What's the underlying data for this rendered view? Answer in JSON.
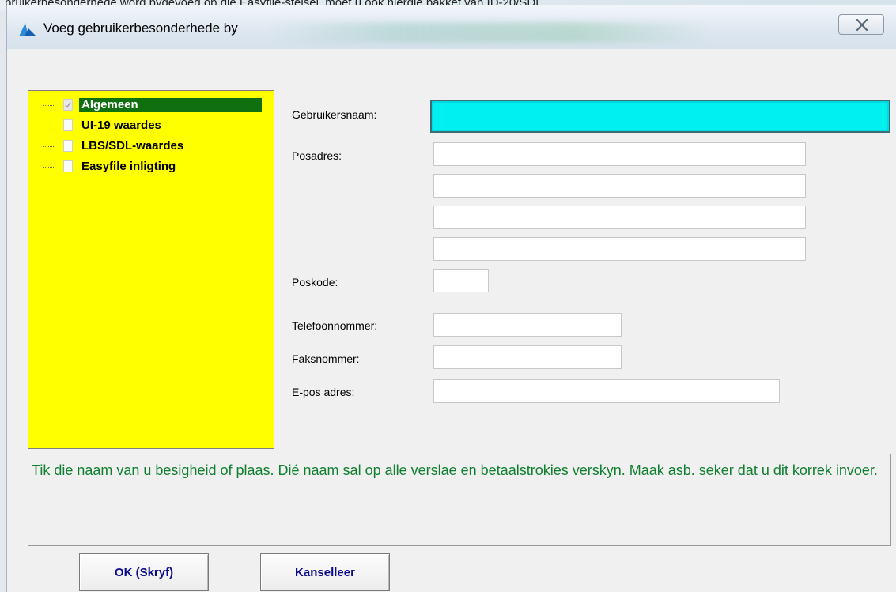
{
  "window": {
    "title": "Voeg gebruikerbesonderhede by",
    "background_text": "bruikerbesonderhede word bygevoeg op die Easyfile-stelsel, moet u ook hierdie pakket van ID-20/SDL..."
  },
  "tree": {
    "items": [
      {
        "label": "Algemeen",
        "selected": true,
        "checked": true
      },
      {
        "label": "UI-19 waardes",
        "selected": false,
        "checked": false
      },
      {
        "label": "LBS/SDL-waardes",
        "selected": false,
        "checked": false
      },
      {
        "label": "Easyfile inligting",
        "selected": false,
        "checked": false
      }
    ]
  },
  "form": {
    "username_label": "Gebruikersnaam:",
    "username_value": "",
    "postal_label": "Posadres:",
    "postal_lines": [
      "",
      "",
      "",
      ""
    ],
    "postcode_label": "Poskode:",
    "postcode_value": "",
    "phone_label": "Telefoonnommer:",
    "phone_value": "",
    "fax_label": "Faksnommer:",
    "fax_value": "",
    "email_label": "E-pos adres:",
    "email_value": ""
  },
  "info": {
    "text": "Tik die naam van u besigheid of plaas. Dié naam sal op alle verslae en betaalstrokies verskyn. Maak asb. seker dat u dit korrek invoer."
  },
  "buttons": {
    "ok_label": "OK (Skryf)",
    "cancel_label": "Kanselleer"
  },
  "colors": {
    "tree_background": "#ffff00",
    "tree_selected": "#107010",
    "focused_input": "#00f0f0",
    "info_text": "#108030",
    "button_text": "#0a0a8a"
  }
}
